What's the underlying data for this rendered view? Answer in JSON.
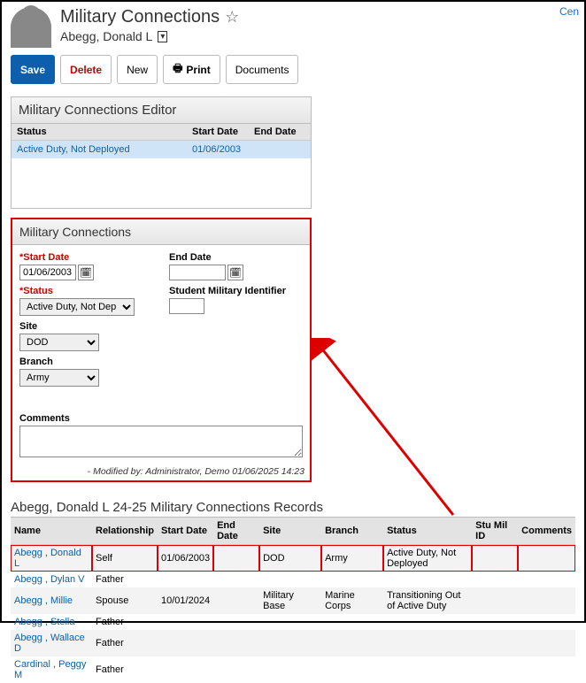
{
  "header": {
    "page_title": "Military Connections",
    "person_name": "Abegg, Donald L",
    "top_right_link": "Cen"
  },
  "toolbar": {
    "save": "Save",
    "delete": "Delete",
    "new": "New",
    "print": "Print",
    "documents": "Documents"
  },
  "editor": {
    "title": "Military Connections Editor",
    "cols": {
      "status": "Status",
      "start": "Start Date",
      "end": "End Date"
    },
    "row": {
      "status": "Active Duty, Not Deployed",
      "start": "01/06/2003",
      "end": ""
    }
  },
  "form": {
    "title": "Military Connections",
    "labels": {
      "start": "Start Date",
      "end": "End Date",
      "status": "Status",
      "smi": "Student Military Identifier",
      "site": "Site",
      "branch": "Branch",
      "comments": "Comments"
    },
    "values": {
      "start": "01/06/2003",
      "end": "",
      "status": "Active Duty, Not Deployed",
      "smi": "",
      "site": "DOD",
      "branch": "Army",
      "comments": ""
    },
    "modified_by": "- Modified by: Administrator, Demo 01/06/2025 14:23"
  },
  "records": {
    "title": "Abegg, Donald L 24-25 Military Connections Records",
    "cols": {
      "name": "Name",
      "rel": "Relationship",
      "start": "Start Date",
      "end": "End Date",
      "site": "Site",
      "branch": "Branch",
      "status": "Status",
      "stumil": "Stu Mil ID",
      "comments": "Comments"
    },
    "rows": [
      {
        "name": "Abegg , Donald L",
        "rel": "Self",
        "start": "01/06/2003",
        "end": "",
        "site": "DOD",
        "branch": "Army",
        "status": "Active Duty, Not Deployed",
        "hl": true
      },
      {
        "name": "Abegg , Dylan V",
        "rel": "Father",
        "start": "",
        "end": "",
        "site": "",
        "branch": "",
        "status": ""
      },
      {
        "name": "Abegg , Millie",
        "rel": "Spouse",
        "start": "10/01/2024",
        "end": "",
        "site": "Military Base",
        "branch": "Marine Corps",
        "status": "Transitioning Out of Active Duty"
      },
      {
        "name": "Abegg , Stella",
        "rel": "Father",
        "start": "",
        "end": "",
        "site": "",
        "branch": "",
        "status": ""
      },
      {
        "name": "Abegg , Wallace D",
        "rel": "Father",
        "start": "",
        "end": "",
        "site": "",
        "branch": "",
        "status": ""
      },
      {
        "name": "Cardinal , Peggy M",
        "rel": "Father",
        "start": "",
        "end": "",
        "site": "",
        "branch": "",
        "status": ""
      }
    ]
  }
}
